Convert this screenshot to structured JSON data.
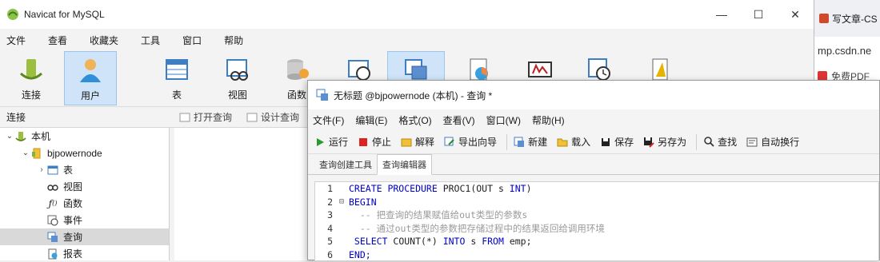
{
  "main_window": {
    "title": "Navicat for MySQL",
    "controls": [
      "—",
      "☐",
      "✕"
    ],
    "menu": [
      "文件",
      "查看",
      "收藏夹",
      "工具",
      "窗口",
      "帮助"
    ],
    "toolbar": [
      {
        "label": "连接",
        "icon": "connection-icon"
      },
      {
        "label": "用户",
        "icon": "user-icon",
        "active": true
      },
      {
        "label": "表",
        "icon": "table-icon"
      },
      {
        "label": "视图",
        "icon": "view-icon"
      },
      {
        "label": "函数",
        "icon": "function-icon"
      },
      {
        "label": "",
        "icon": "event-icon"
      },
      {
        "label": "",
        "icon": "query-icon"
      },
      {
        "label": "",
        "icon": "report-icon"
      },
      {
        "label": "",
        "icon": "backup-icon"
      },
      {
        "label": "",
        "icon": "schedule-icon"
      },
      {
        "label": "",
        "icon": "model-icon"
      }
    ],
    "connection_label": "连接",
    "object_buttons": {
      "open_query": "打开查询",
      "design_query": "设计查询"
    },
    "tree": [
      {
        "label": "本机",
        "level": 0,
        "expanded": true,
        "icon": "connection-icon"
      },
      {
        "label": "bjpowernode",
        "level": 1,
        "expanded": true,
        "icon": "database-icon"
      },
      {
        "label": "表",
        "level": 2,
        "expanded": false,
        "icon": "table-icon"
      },
      {
        "label": "视图",
        "level": 2,
        "icon": "view-icon"
      },
      {
        "label": "函数",
        "level": 2,
        "icon": "function-icon"
      },
      {
        "label": "事件",
        "level": 2,
        "icon": "event-icon"
      },
      {
        "label": "查询",
        "level": 2,
        "icon": "query-icon",
        "selected": true
      },
      {
        "label": "报表",
        "level": 2,
        "icon": "report-icon"
      }
    ]
  },
  "browser": {
    "tab_title": "写文章-CS",
    "url": "mp.csdn.ne",
    "bookmark": "免费PDF"
  },
  "query_window": {
    "title": "无标题 @bjpowernode (本机) - 查询 *",
    "menu": [
      "文件(F)",
      "编辑(E)",
      "格式(O)",
      "查看(V)",
      "窗口(W)",
      "帮助(H)"
    ],
    "toolbar": [
      {
        "label": "运行",
        "icon": "run-icon"
      },
      {
        "label": "停止",
        "icon": "stop-icon"
      },
      {
        "label": "解释",
        "icon": "explain-icon"
      },
      {
        "label": "导出向导",
        "icon": "export-icon"
      },
      {
        "label": "新建",
        "icon": "new-icon"
      },
      {
        "label": "载入",
        "icon": "load-icon"
      },
      {
        "label": "保存",
        "icon": "save-icon"
      },
      {
        "label": "另存为",
        "icon": "save-as-icon"
      },
      {
        "label": "查找",
        "icon": "search-icon"
      },
      {
        "label": "自动换行",
        "icon": "wrap-icon"
      }
    ],
    "tabs": [
      {
        "label": "查询创建工具",
        "active": false
      },
      {
        "label": "查询编辑器",
        "active": true
      }
    ],
    "code": [
      {
        "n": "1",
        "fold": "",
        "parts": [
          [
            "kw",
            "CREATE PROCEDURE "
          ],
          [
            "id",
            "PROC1(OUT s "
          ],
          [
            "kw",
            "INT"
          ],
          [
            "id",
            ")"
          ]
        ]
      },
      {
        "n": "2",
        "fold": "⊟",
        "parts": [
          [
            "kw",
            "BEGIN"
          ]
        ]
      },
      {
        "n": "3",
        "fold": "",
        "parts": [
          [
            "cm",
            "  -- 把查询的结果赋值给out类型的参数s"
          ]
        ]
      },
      {
        "n": "4",
        "fold": "",
        "parts": [
          [
            "cm",
            "  -- 通过out类型的参数把存储过程中的结果返回给调用环境"
          ]
        ]
      },
      {
        "n": "5",
        "fold": "",
        "parts": [
          [
            "kw",
            " SELECT "
          ],
          [
            "id",
            "COUNT(*) "
          ],
          [
            "kw",
            "INTO "
          ],
          [
            "id",
            "s "
          ],
          [
            "kw",
            "FROM "
          ],
          [
            "id",
            "emp;"
          ]
        ]
      },
      {
        "n": "6",
        "fold": "",
        "parts": [
          [
            "kw",
            "END;"
          ]
        ]
      }
    ]
  },
  "colors": {
    "keyword": "#0000c8",
    "comment": "#9a9a9a",
    "selection": "#cfe4f8"
  }
}
